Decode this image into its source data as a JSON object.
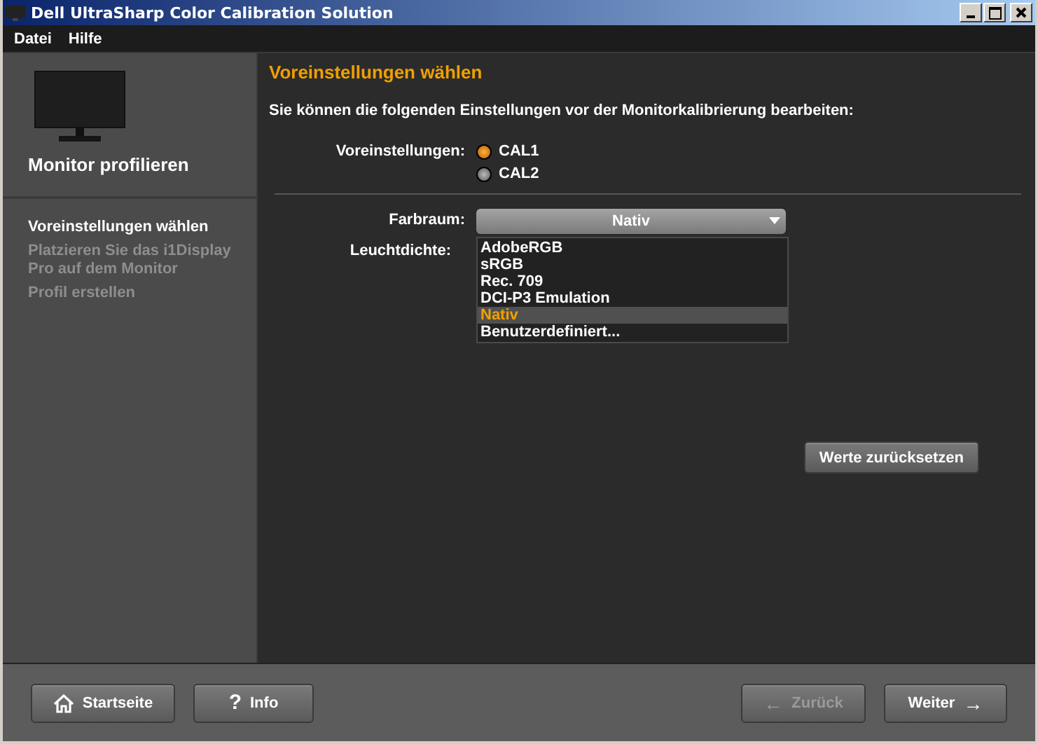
{
  "window": {
    "title": "Dell UltraSharp Color Calibration Solution"
  },
  "menu": [
    "Datei",
    "Hilfe"
  ],
  "sidebar": {
    "title": "Monitor profilieren",
    "steps": [
      {
        "label": "Voreinstellungen wählen",
        "selected": true
      },
      {
        "label": "Platzieren Sie das i1Display Pro auf dem Monitor",
        "selected": false
      },
      {
        "label": "Profil erstellen",
        "selected": false
      }
    ]
  },
  "main": {
    "heading": "Voreinstellungen wählen",
    "intro": "Sie können die folgenden Einstellungen vor der Monitorkalibrierung bearbeiten:",
    "presets": {
      "label": "Voreinstellungen:",
      "options": [
        {
          "label": "CAL1",
          "selected": true
        },
        {
          "label": "CAL2",
          "selected": false
        }
      ]
    },
    "colorspace": {
      "label": "Farbraum:",
      "value": "Nativ",
      "expanded": true,
      "options": [
        {
          "label": "AdobeRGB",
          "selected": false
        },
        {
          "label": "sRGB",
          "selected": false
        },
        {
          "label": "Rec. 709",
          "selected": false
        },
        {
          "label": "DCI-P3 Emulation",
          "selected": false
        },
        {
          "label": "Nativ",
          "selected": true
        },
        {
          "label": "Benutzerdefiniert...",
          "selected": false
        }
      ]
    },
    "luminance": {
      "label": "Leuchtdichte:"
    },
    "reset_button": "Werte zurücksetzen"
  },
  "footer": [
    {
      "label": "Startseite",
      "kind": "home",
      "disabled": false
    },
    {
      "label": "Info",
      "kind": "glyph",
      "glyph": "?",
      "disabled": false
    },
    {
      "label": "Zurück",
      "kind": "back",
      "glyph": "←",
      "disabled": true
    },
    {
      "label": "Weiter",
      "kind": "next",
      "glyph": "→",
      "disabled": false
    }
  ]
}
